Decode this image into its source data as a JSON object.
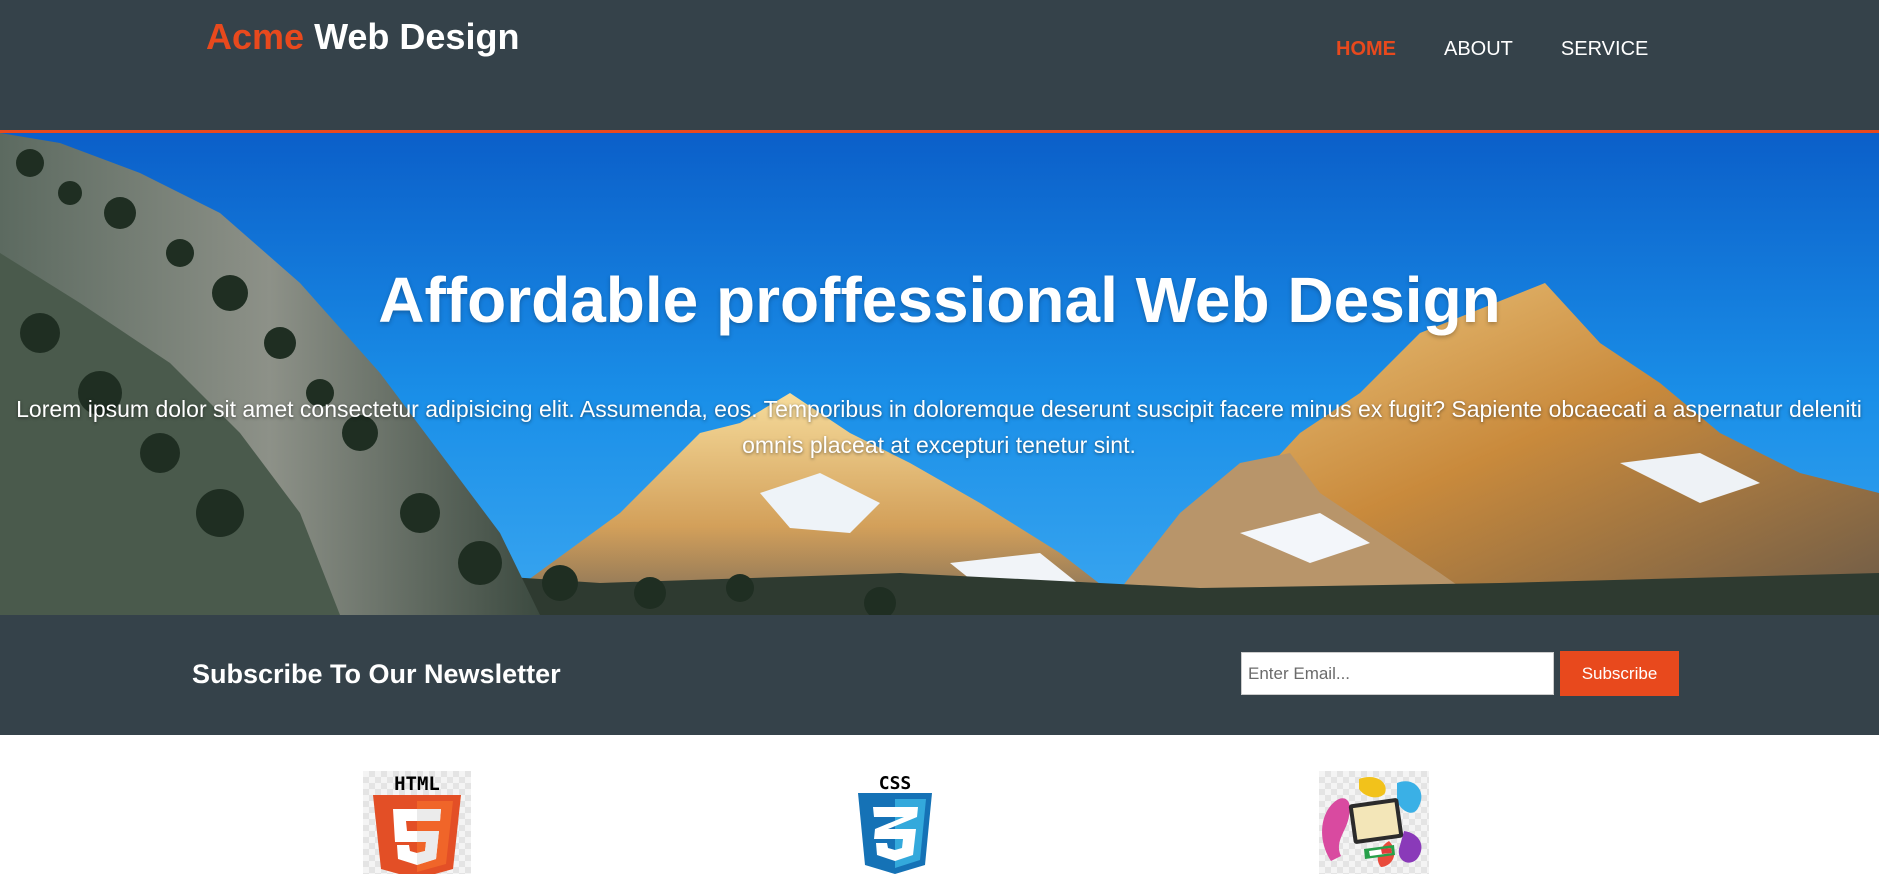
{
  "header": {
    "brand_accent": "Acme",
    "brand_rest": " Web Design",
    "nav": [
      {
        "label": "HOME",
        "active": true
      },
      {
        "label": "ABOUT",
        "active": false
      },
      {
        "label": "SERVICE",
        "active": false
      }
    ]
  },
  "showcase": {
    "title": "Affordable proffessional Web Design",
    "text": "Lorem ipsum dolor sit amet consectetur adipisicing elit. Assumenda, eos. Temporibus in doloremque deserunt suscipit facere minus ex fugit? Sapiente obcaecati a aspernatur deleniti omnis placeat at excepturi tenetur sint."
  },
  "newsletter": {
    "heading": "Subscribe To Our Newsletter",
    "email_placeholder": "Enter Email...",
    "button_label": "Subscribe"
  },
  "boxes": {
    "html_icon_label": "HTML",
    "css_icon_label": "CSS"
  },
  "colors": {
    "header_bg": "#35424a",
    "accent": "#e8491d",
    "white": "#ffffff"
  },
  "icons": [
    "html5-logo-icon",
    "css3-logo-icon",
    "graphic-design-icon"
  ]
}
